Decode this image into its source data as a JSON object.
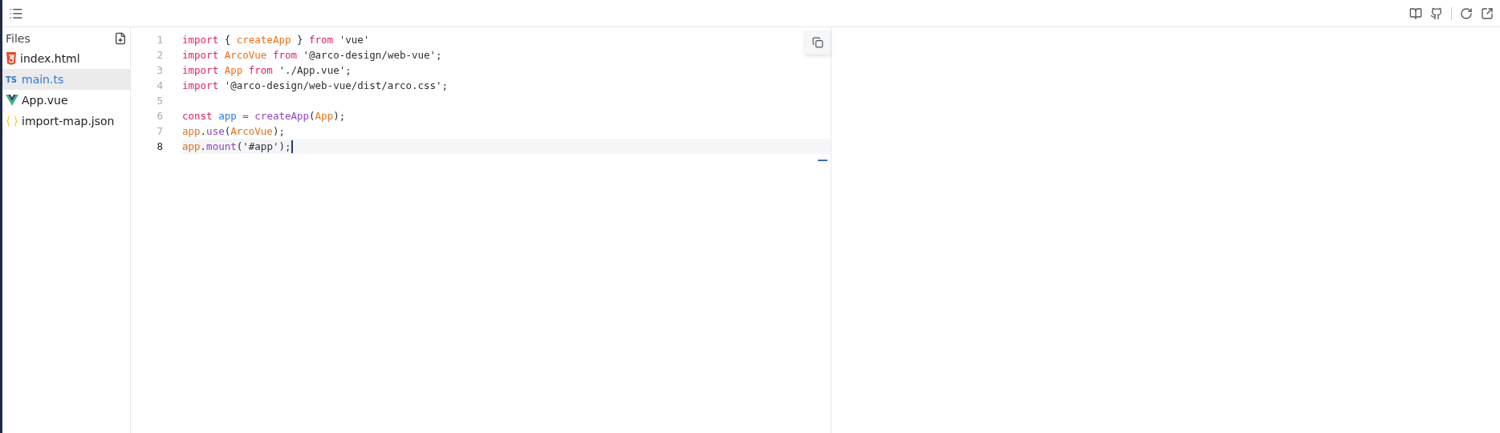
{
  "sidebar": {
    "title": "Files",
    "files": [
      {
        "name": "index.html",
        "kind": "html",
        "selected": false
      },
      {
        "name": "main.ts",
        "kind": "ts",
        "badge": "TS",
        "selected": true
      },
      {
        "name": "App.vue",
        "kind": "vue",
        "selected": false
      },
      {
        "name": "import-map.json",
        "kind": "json",
        "selected": false
      }
    ]
  },
  "editor": {
    "lines": [
      {
        "number": "1",
        "active": false,
        "tokens": [
          {
            "kind": "keyword",
            "text": "import"
          },
          {
            "kind": "punct",
            "text": " { "
          },
          {
            "kind": "ident",
            "text": "createApp"
          },
          {
            "kind": "punct",
            "text": " } "
          },
          {
            "kind": "keyword",
            "text": "from"
          },
          {
            "kind": "string",
            "text": " 'vue'"
          }
        ]
      },
      {
        "number": "2",
        "active": false,
        "tokens": [
          {
            "kind": "keyword",
            "text": "import"
          },
          {
            "kind": "ident",
            "text": " ArcoVue"
          },
          {
            "kind": "keyword",
            "text": " from"
          },
          {
            "kind": "string",
            "text": " '@arco-design/web-vue'"
          },
          {
            "kind": "punct",
            "text": ";"
          }
        ]
      },
      {
        "number": "3",
        "active": false,
        "tokens": [
          {
            "kind": "keyword",
            "text": "import"
          },
          {
            "kind": "ident",
            "text": " App"
          },
          {
            "kind": "keyword",
            "text": " from"
          },
          {
            "kind": "string",
            "text": " './App.vue'"
          },
          {
            "kind": "punct",
            "text": ";"
          }
        ]
      },
      {
        "number": "4",
        "active": false,
        "tokens": [
          {
            "kind": "keyword",
            "text": "import"
          },
          {
            "kind": "string",
            "text": " '@arco-design/web-vue/dist/arco.css'"
          },
          {
            "kind": "punct",
            "text": ";"
          }
        ]
      },
      {
        "number": "5",
        "active": false
      },
      {
        "number": "6",
        "active": false,
        "tokens": [
          {
            "kind": "keyword",
            "text": "const"
          },
          {
            "kind": "variable",
            "text": " app"
          },
          {
            "kind": "keyword",
            "text": " = "
          },
          {
            "kind": "function",
            "text": "createApp"
          },
          {
            "kind": "punct",
            "text": "("
          },
          {
            "kind": "ident",
            "text": "App"
          },
          {
            "kind": "punct",
            "text": ");"
          }
        ]
      },
      {
        "number": "7",
        "active": false,
        "tokens": [
          {
            "kind": "ident",
            "text": "app"
          },
          {
            "kind": "punct",
            "text": "."
          },
          {
            "kind": "function",
            "text": "use"
          },
          {
            "kind": "punct",
            "text": "("
          },
          {
            "kind": "ident",
            "text": "ArcoVue"
          },
          {
            "kind": "punct",
            "text": ");"
          }
        ]
      },
      {
        "number": "8",
        "active": true,
        "tokens": [
          {
            "kind": "ident",
            "text": "app"
          },
          {
            "kind": "punct",
            "text": "."
          },
          {
            "kind": "function",
            "text": "mount"
          },
          {
            "kind": "punct",
            "text": "("
          },
          {
            "kind": "string",
            "text": "'#app'"
          },
          {
            "kind": "punct",
            "text": ");"
          }
        ]
      }
    ]
  }
}
